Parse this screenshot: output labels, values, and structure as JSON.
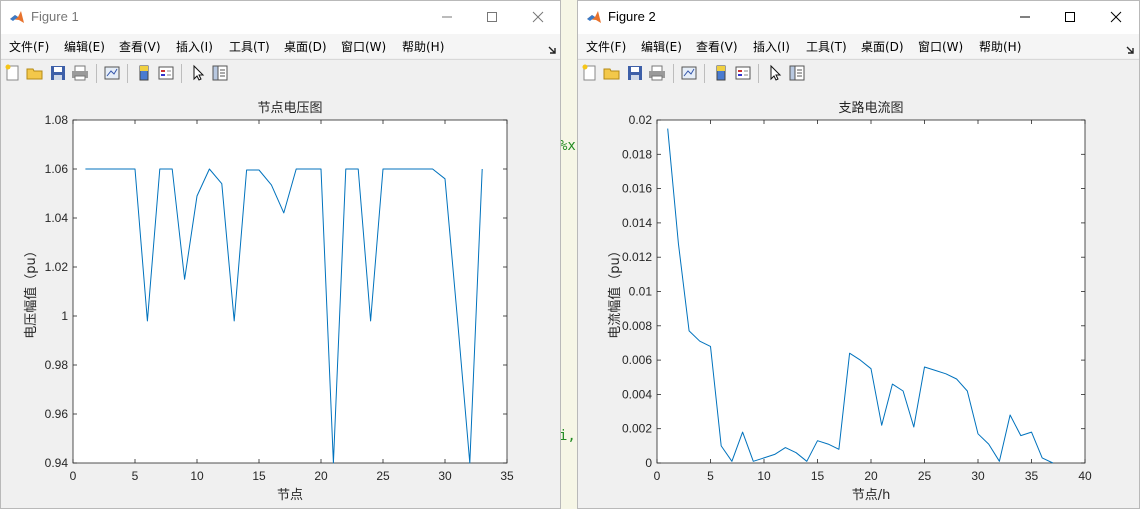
{
  "figures": [
    {
      "window_title": "Figure 1",
      "menu": [
        "文件(F)",
        "编辑(E)",
        "查看(V)",
        "插入(I)",
        "工具(T)",
        "桌面(D)",
        "窗口(W)",
        "帮助(H)"
      ],
      "chart_data": {
        "type": "line",
        "title": "节点电压图",
        "xlabel": "节点",
        "ylabel": "电压幅值（pu）",
        "xlim": [
          0,
          35
        ],
        "ylim": [
          0.94,
          1.08
        ],
        "xticks": [
          0,
          5,
          10,
          15,
          20,
          25,
          30,
          35
        ],
        "yticks": [
          0.94,
          0.96,
          0.98,
          1,
          1.02,
          1.04,
          1.06,
          1.08
        ],
        "grid": false,
        "series_color": "#0072bd",
        "x": [
          1,
          2,
          3,
          4,
          5,
          6,
          7,
          8,
          9,
          10,
          11,
          12,
          13,
          14,
          15,
          16,
          17,
          18,
          19,
          20,
          21,
          22,
          23,
          24,
          25,
          26,
          27,
          28,
          29,
          30,
          31,
          32,
          33
        ],
        "y": [
          1.06,
          1.06,
          1.06,
          1.06,
          1.06,
          0.998,
          1.06,
          1.06,
          1.015,
          1.049,
          1.06,
          1.054,
          0.998,
          1.0596,
          1.0596,
          1.0535,
          1.0421,
          1.06,
          1.06,
          1.06,
          0.94,
          1.06,
          1.06,
          0.998,
          1.06,
          1.06,
          1.06,
          1.06,
          1.06,
          1.056,
          0.999,
          0.94,
          1.06
        ]
      }
    },
    {
      "window_title": "Figure 2",
      "menu": [
        "文件(F)",
        "编辑(E)",
        "查看(V)",
        "插入(I)",
        "工具(T)",
        "桌面(D)",
        "窗口(W)",
        "帮助(H)"
      ],
      "chart_data": {
        "type": "line",
        "title": "支路电流图",
        "xlabel": "节点/h",
        "ylabel": "电流幅值（pu）",
        "xlim": [
          0,
          40
        ],
        "ylim": [
          0,
          0.02
        ],
        "xticks": [
          0,
          5,
          10,
          15,
          20,
          25,
          30,
          35,
          40
        ],
        "yticks": [
          0,
          0.002,
          0.004,
          0.006,
          0.008,
          0.01,
          0.012,
          0.014,
          0.016,
          0.018,
          0.02
        ],
        "grid": false,
        "series_color": "#0072bd",
        "x": [
          1,
          2,
          3,
          4,
          5,
          6,
          7,
          8,
          9,
          10,
          11,
          12,
          13,
          14,
          15,
          16,
          17,
          18,
          19,
          20,
          21,
          22,
          23,
          24,
          25,
          26,
          27,
          28,
          29,
          30,
          31,
          32,
          33,
          34,
          35,
          36,
          37
        ],
        "y": [
          0.0195,
          0.0128,
          0.0077,
          0.0071,
          0.0068,
          0.001,
          0.0001,
          0.0018,
          0.0001,
          0.0003,
          0.0005,
          0.0009,
          0.0006,
          0.0001,
          0.0013,
          0.0011,
          0.0008,
          0.0064,
          0.006,
          0.0055,
          0.0022,
          0.0046,
          0.0042,
          0.0021,
          0.0056,
          0.0054,
          0.0052,
          0.0049,
          0.0042,
          0.0017,
          0.0011,
          0.0001,
          0.0028,
          0.0016,
          0.0018,
          0.0003,
          0.0
        ]
      }
    }
  ],
  "background_code": [
    {
      "text": "%x",
      "top": 0
    },
    {
      "text": "i,",
      "top": 0
    }
  ]
}
